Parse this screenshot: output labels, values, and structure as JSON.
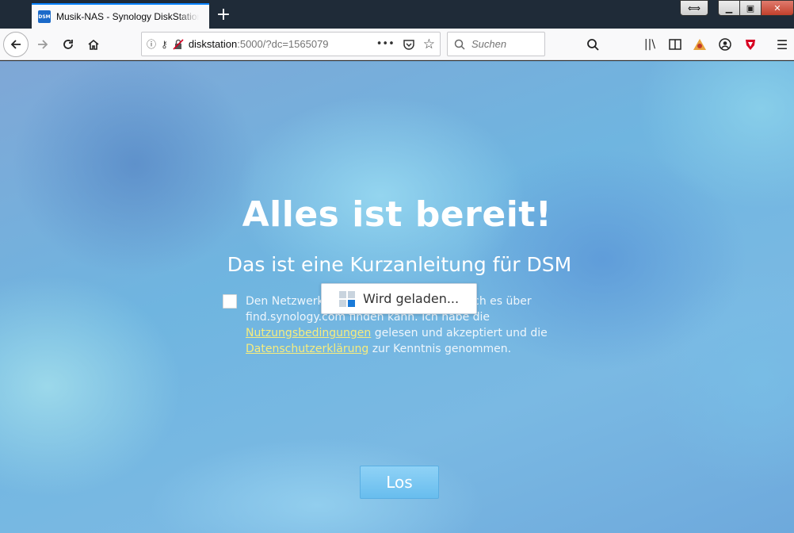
{
  "browser": {
    "tab": {
      "favicon_text": "DSM",
      "title": "Musik-NAS - Synology DiskStation"
    },
    "new_tab_icon": "plus-icon",
    "window_controls": [
      "ext-restore-icon",
      "minimize-icon",
      "maximize-icon",
      "close-icon"
    ],
    "url": {
      "host": "diskstation",
      "rest": ":5000/?dc=1565079"
    },
    "search_placeholder": "Suchen",
    "toolbar_icons": [
      "search-icon",
      "library-icon",
      "reader-view-icon",
      "extension-icon",
      "account-icon",
      "shield-extension-icon",
      "menu-icon"
    ],
    "accent_color": "#0a84ff"
  },
  "page": {
    "headline": "Alles ist bereit!",
    "subheadline": "Das ist eine Kurzanleitung für DSM",
    "consent": {
      "part1": "Den Netzwerk",
      "part1_suffix": " Gerätes freigeben, damit ich es über find.synology.com finden kann. Ich habe die ",
      "terms_link": "Nutzungsbedingungen",
      "part2": " gelesen und akzeptiert und die ",
      "privacy_link": "Datenschutzerklärung",
      "part3": " zur Kenntnis genommen."
    },
    "loading_text": "Wird geladen...",
    "go_button": "Los",
    "link_color": "#f6ec7e"
  }
}
